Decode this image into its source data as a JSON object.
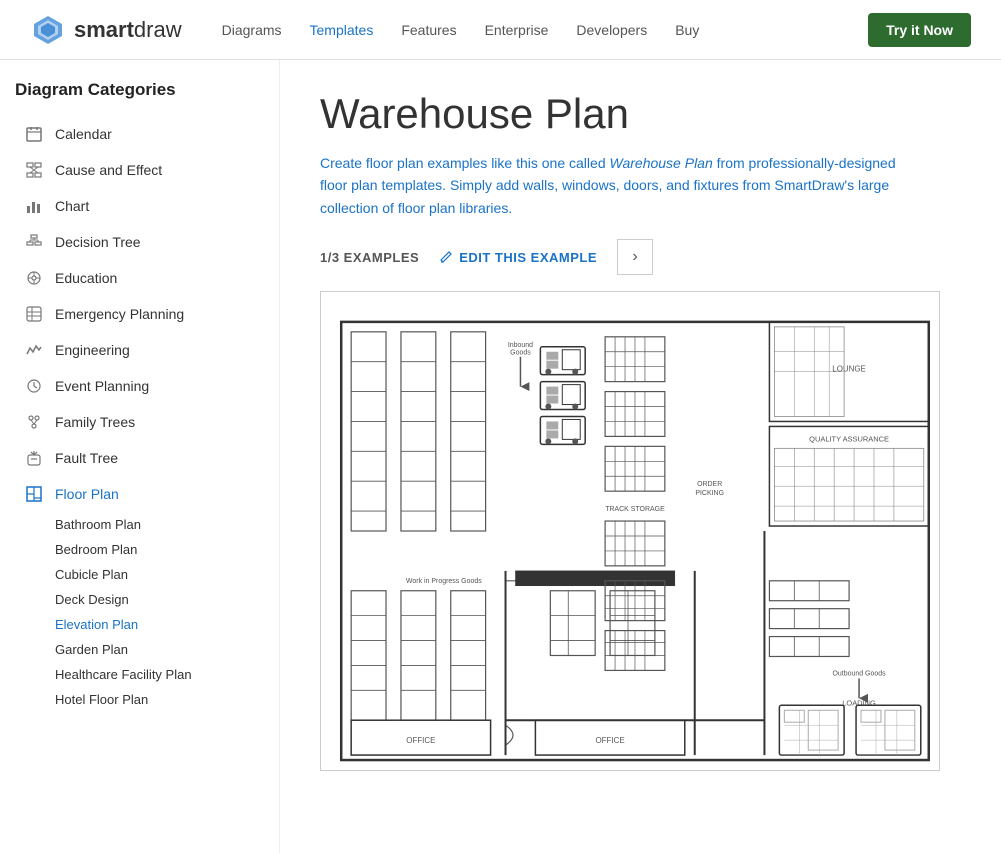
{
  "header": {
    "logo_bold": "smart",
    "logo_light": "draw",
    "nav_items": [
      {
        "label": "Diagrams",
        "active": false
      },
      {
        "label": "Templates",
        "active": true
      },
      {
        "label": "Features",
        "active": false
      },
      {
        "label": "Enterprise",
        "active": false
      },
      {
        "label": "Developers",
        "active": false
      },
      {
        "label": "Buy",
        "active": false
      }
    ],
    "cta_label": "Try it Now"
  },
  "sidebar": {
    "title": "Diagram Categories",
    "items": [
      {
        "label": "Calendar",
        "icon": "calendar"
      },
      {
        "label": "Cause and Effect",
        "icon": "cause-effect"
      },
      {
        "label": "Chart",
        "icon": "chart"
      },
      {
        "label": "Decision Tree",
        "icon": "decision-tree"
      },
      {
        "label": "Education",
        "icon": "education"
      },
      {
        "label": "Emergency Planning",
        "icon": "emergency"
      },
      {
        "label": "Engineering",
        "icon": "engineering"
      },
      {
        "label": "Event Planning",
        "icon": "event"
      },
      {
        "label": "Family Trees",
        "icon": "family"
      },
      {
        "label": "Fault Tree",
        "icon": "fault"
      },
      {
        "label": "Floor Plan",
        "icon": "floor-plan",
        "active": true
      }
    ],
    "sub_items": [
      {
        "label": "Bathroom Plan",
        "active": false
      },
      {
        "label": "Bedroom Plan",
        "active": false
      },
      {
        "label": "Cubicle Plan",
        "active": false
      },
      {
        "label": "Deck Design",
        "active": false
      },
      {
        "label": "Elevation Plan",
        "active": true
      },
      {
        "label": "Garden Plan",
        "active": false
      },
      {
        "label": "Healthcare Facility Plan",
        "active": false
      },
      {
        "label": "Hotel Floor Plan",
        "active": false
      }
    ]
  },
  "main": {
    "title": "Warehouse Plan",
    "description_parts": [
      "Create floor plan examples like this one called ",
      "Warehouse Plan",
      " from professionally-designed floor plan templates. Simply add walls, windows, doors, and fixtures from SmartDraw's large collection of floor plan libraries."
    ],
    "example_count": "1/3 EXAMPLES",
    "edit_label": "EDIT THIS EXAMPLE",
    "next_label": "›"
  }
}
